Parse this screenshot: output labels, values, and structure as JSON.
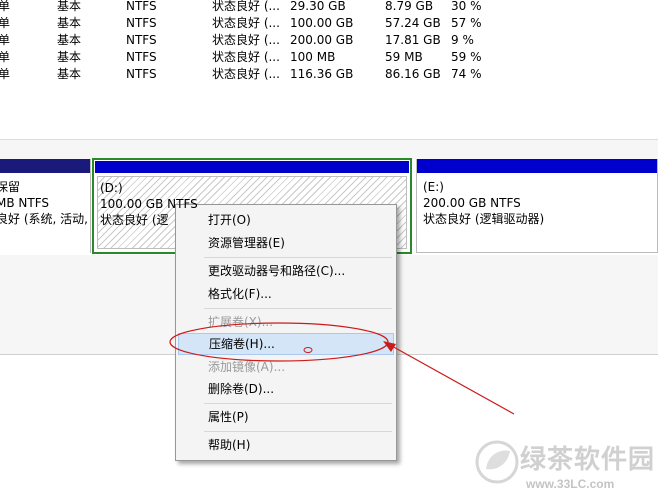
{
  "volumes": [
    {
      "layout": "单",
      "type": "基本",
      "fs": "NTFS",
      "status": "状态良好 (...",
      "capacity": "29.30 GB",
      "free": "8.79 GB",
      "pct": "30 %"
    },
    {
      "layout": "单",
      "type": "基本",
      "fs": "NTFS",
      "status": "状态良好 (...",
      "capacity": "100.00 GB",
      "free": "57.24 GB",
      "pct": "57 %"
    },
    {
      "layout": "单",
      "type": "基本",
      "fs": "NTFS",
      "status": "状态良好 (...",
      "capacity": "200.00 GB",
      "free": "17.81 GB",
      "pct": "9 %"
    },
    {
      "layout": "单",
      "type": "基本",
      "fs": "NTFS",
      "status": "状态良好 (...",
      "capacity": "100 MB",
      "free": "59 MB",
      "pct": "59 %"
    },
    {
      "layout": "单",
      "type": "基本",
      "fs": "NTFS",
      "status": "状态良好 (...",
      "capacity": "116.36 GB",
      "free": "86.16 GB",
      "pct": "74 %"
    }
  ],
  "partitions": {
    "system": {
      "line1": "保留",
      "line2": "MB NTFS",
      "line3": "良好 (系统, 活动,"
    },
    "d": {
      "line1": "(D:)",
      "line2": "100.00 GB NTFS",
      "line3": "状态良好 (逻"
    },
    "e": {
      "line1": "(E:)",
      "line2": "200.00 GB NTFS",
      "line3": "状态良好 (逻辑驱动器)"
    }
  },
  "context_menu": {
    "open": "打开(O)",
    "explorer": "资源管理器(E)",
    "change_letter": "更改驱动器号和路径(C)...",
    "format": "格式化(F)...",
    "extend": "扩展卷(X)...",
    "shrink": "压缩卷(H)...",
    "mirror": "添加镜像(A)...",
    "delete": "删除卷(D)...",
    "properties": "属性(P)",
    "help": "帮助(H)"
  },
  "colors": {
    "partition_bar": "#0000cd",
    "selected_border": "#2a8a2a",
    "annotation": "#cc1a1a",
    "menu_hover": "#d4e5f7"
  },
  "watermark": {
    "name": "绿茶软件园",
    "url": "www.33LC.com"
  }
}
